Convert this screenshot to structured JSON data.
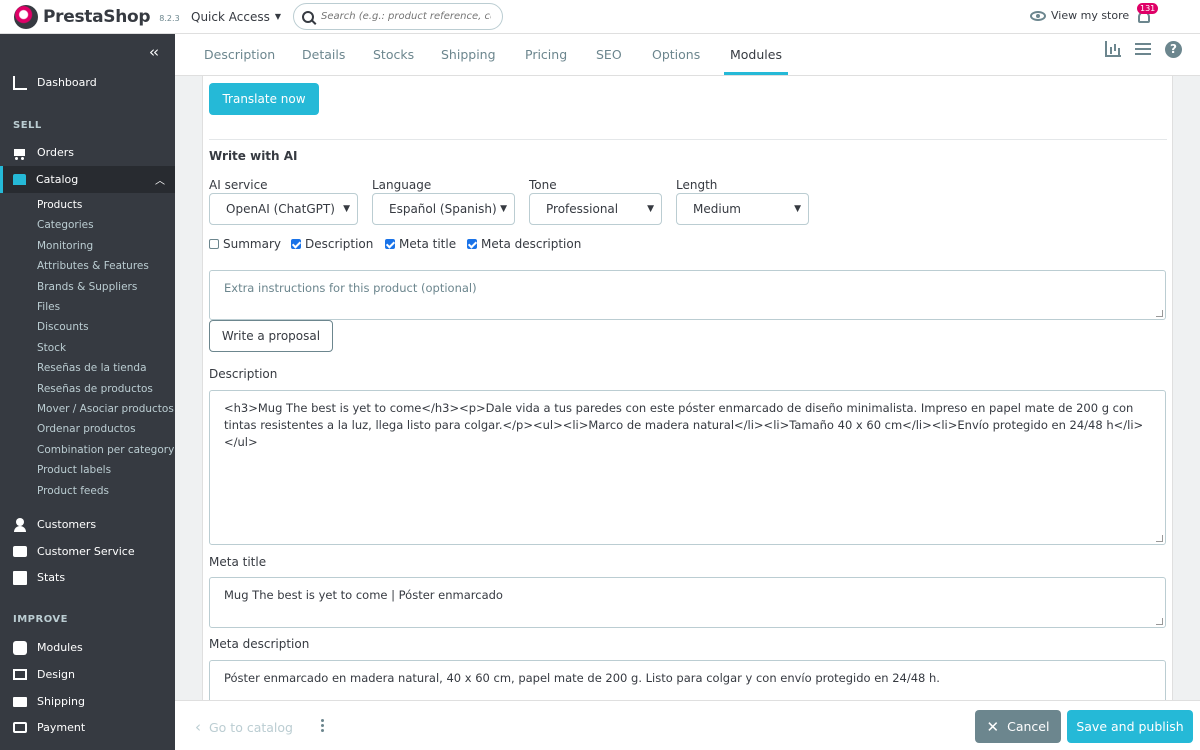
{
  "header": {
    "brand": "PrestaShop",
    "version": "8.2.3",
    "quick_access": "Quick Access",
    "search_placeholder": "Search (e.g.: product reference, custon",
    "view_store": "View my store",
    "notifications_count": "131"
  },
  "sidebar": {
    "dashboard": "Dashboard",
    "sell_title": "SELL",
    "orders": "Orders",
    "catalog": "Catalog",
    "catalog_items": [
      "Products",
      "Categories",
      "Monitoring",
      "Attributes & Features",
      "Brands & Suppliers",
      "Files",
      "Discounts",
      "Stock",
      "Reseñas de la tienda",
      "Reseñas de productos",
      "Mover / Asociar productos",
      "Ordenar productos",
      "Combination per category",
      "Product labels",
      "Product feeds"
    ],
    "customers": "Customers",
    "customer_service": "Customer Service",
    "stats": "Stats",
    "improve_title": "IMPROVE",
    "modules": "Modules",
    "design": "Design",
    "shipping": "Shipping",
    "payment": "Payment"
  },
  "tabs": [
    "Description",
    "Details",
    "Stocks",
    "Shipping",
    "Pricing",
    "SEO",
    "Options",
    "Modules"
  ],
  "active_tab": "Modules",
  "module": {
    "translate_button": "Translate now",
    "write_ai_title": "Write with AI",
    "ai_service_label": "AI service",
    "ai_service_value": "OpenAI (ChatGPT)",
    "language_label": "Language",
    "language_value": "Español (Spanish)",
    "tone_label": "Tone",
    "tone_value": "Professional",
    "length_label": "Length",
    "length_value": "Medium",
    "checkboxes": [
      {
        "label": "Summary",
        "checked": false
      },
      {
        "label": "Description",
        "checked": true
      },
      {
        "label": "Meta title",
        "checked": true
      },
      {
        "label": "Meta description",
        "checked": true
      }
    ],
    "instructions_placeholder": "Extra instructions for this product (optional)",
    "write_proposal_button": "Write a proposal",
    "description_label": "Description",
    "description_value": "<h3>Mug The best is yet to come</h3><p>Dale vida a tus paredes con este póster enmarcado de diseño minimalista. Impreso en papel mate de 200 g con tintas resistentes a la luz, llega listo para colgar.</p><ul><li>Marco de madera natural</li><li>Tamaño 40 x 60 cm</li><li>Envío protegido en 24/48 h</li></ul>",
    "meta_title_label": "Meta title",
    "meta_title_value": "Mug The best is yet to come | Póster enmarcado",
    "meta_description_label": "Meta description",
    "meta_description_value": "Póster enmarcado en madera natural, 40 x 60 cm, papel mate de 200 g. Listo para colgar y con envío protegido en 24/48 h."
  },
  "footer": {
    "go_to_catalog": "Go to catalog",
    "cancel": "Cancel",
    "save_publish": "Save and publish"
  },
  "colors": {
    "accent": "#25b9d7",
    "sidebar_bg": "#363a41",
    "brand_pink": "#df0067"
  }
}
